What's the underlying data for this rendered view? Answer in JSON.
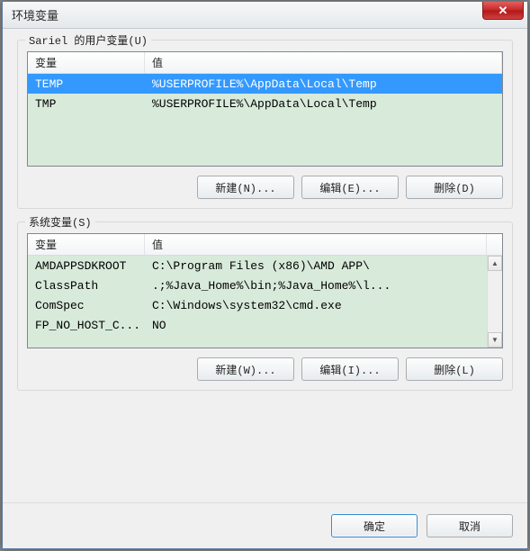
{
  "window": {
    "title": "环境变量"
  },
  "close": {
    "glyph": "✕"
  },
  "user_section": {
    "label": "Sariel 的用户变量(U)",
    "headers": {
      "var": "变量",
      "val": "值"
    },
    "rows": [
      {
        "var": "TEMP",
        "val": "%USERPROFILE%\\AppData\\Local\\Temp",
        "selected": true
      },
      {
        "var": "TMP",
        "val": "%USERPROFILE%\\AppData\\Local\\Temp",
        "selected": false
      }
    ],
    "buttons": {
      "new": "新建(N)...",
      "edit": "编辑(E)...",
      "delete": "删除(D)"
    }
  },
  "system_section": {
    "label": "系统变量(S)",
    "headers": {
      "var": "变量",
      "val": "值"
    },
    "rows": [
      {
        "var": "AMDAPPSDKROOT",
        "val": "C:\\Program Files (x86)\\AMD APP\\"
      },
      {
        "var": "ClassPath",
        "val": ".;%Java_Home%\\bin;%Java_Home%\\l..."
      },
      {
        "var": "ComSpec",
        "val": "C:\\Windows\\system32\\cmd.exe"
      },
      {
        "var": "FP_NO_HOST_C...",
        "val": "NO"
      }
    ],
    "buttons": {
      "new": "新建(W)...",
      "edit": "编辑(I)...",
      "delete": "删除(L)"
    },
    "scroll": {
      "up": "▲",
      "down": "▼"
    }
  },
  "footer": {
    "ok": "确定",
    "cancel": "取消"
  }
}
